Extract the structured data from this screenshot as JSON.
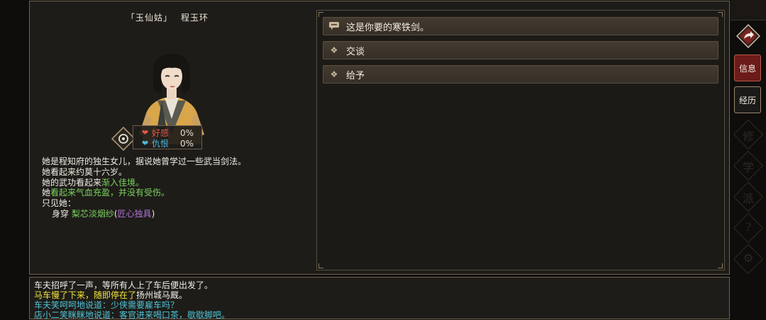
{
  "npc": {
    "title_left": "「玉仙姑」",
    "title_name": "程玉环",
    "relations": [
      {
        "label": "好感",
        "value": "0%",
        "color": "#e3584a"
      },
      {
        "label": "仇恨",
        "value": "0%",
        "color": "#4fb8e0"
      }
    ],
    "desc": {
      "line1": "她是程知府的独生女儿，据说她曾学过一些武当剑法。",
      "line2": "她看起来约莫十六岁。",
      "line3_a": "她的武功看起来",
      "line3_b": "渐入佳境。",
      "line4_a": "她",
      "line4_b": "看起来气血充盈，并没有受伤。",
      "line5": "只见她：",
      "line6_a": "身穿",
      "line6_b": "梨芯淡烟纱",
      "line6_c": "(",
      "line6_d": "匠心独具",
      "line6_e": ")"
    }
  },
  "dialog_options": [
    {
      "label": "这是你要的寒铁剑。",
      "icon": "chat-icon"
    },
    {
      "label": "交谈",
      "icon": "diamond-icon"
    },
    {
      "label": "给予",
      "icon": "diamond-icon"
    }
  ],
  "log": {
    "line1": "车夫招呼了一声，等所有人上了车后便出发了。",
    "line2_a": "马车慢了下来，随即停在了",
    "line2_b": "扬州城马厩。",
    "line3": "车夫笑呵呵地说道：少侠需要雇车吗？",
    "line4": "店小二笑眯眯地说道：客官进来喝口茶，歇歇脚吧。"
  },
  "sidebar": {
    "info_label": "信息",
    "history_label": "经历",
    "ghost1": "修",
    "ghost2": "学",
    "ghost3": "派",
    "ghost4": "?",
    "ghost5": "⚙"
  },
  "colors": {
    "green": "#7bd25d",
    "purple": "#b171d9",
    "yellow": "#f2e63a",
    "cyan": "#4fc4d8",
    "active_red": "#6b1b19"
  }
}
